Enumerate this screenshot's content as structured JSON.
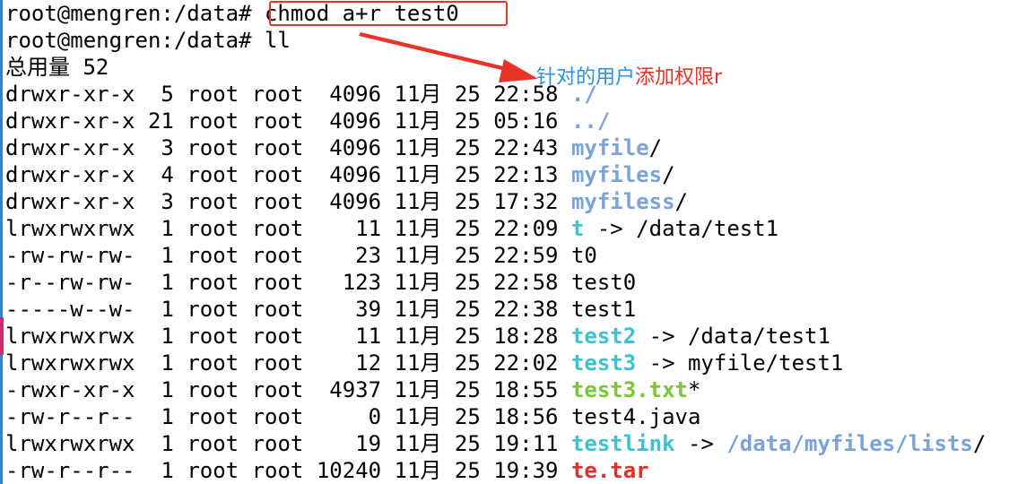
{
  "terminal": {
    "lines": [
      {
        "kind": "prompt",
        "prompt": "root@mengren:/data# ",
        "command": "chmod a+r test0"
      },
      {
        "kind": "prompt",
        "prompt": "root@mengren:/data# ",
        "command": "ll"
      },
      {
        "kind": "total",
        "text": "总用量 52"
      },
      {
        "kind": "entry",
        "perms": "drwxr-xr-x",
        "links": "5",
        "owner": "root",
        "group": "root",
        "size": "4096",
        "month": "11月",
        "day": "25",
        "time": "22:58",
        "name": "./",
        "name_color": "#7ba3d6",
        "name_bold": true
      },
      {
        "kind": "entry",
        "perms": "drwxr-xr-x",
        "links": "21",
        "owner": "root",
        "group": "root",
        "size": "4096",
        "month": "11月",
        "day": "25",
        "time": "05:16",
        "name": "../",
        "name_color": "#7ba3d6",
        "name_bold": true
      },
      {
        "kind": "entry",
        "perms": "drwxr-xr-x",
        "links": "3",
        "owner": "root",
        "group": "root",
        "size": "4096",
        "month": "11月",
        "day": "25",
        "time": "22:43",
        "name": "myfile",
        "suffix": "/",
        "name_color": "#7ba3d6",
        "name_bold": true
      },
      {
        "kind": "entry",
        "perms": "drwxr-xr-x",
        "links": "4",
        "owner": "root",
        "group": "root",
        "size": "4096",
        "month": "11月",
        "day": "25",
        "time": "22:13",
        "name": "myfiles",
        "suffix": "/",
        "name_color": "#7ba3d6",
        "name_bold": true
      },
      {
        "kind": "entry",
        "perms": "drwxr-xr-x",
        "links": "3",
        "owner": "root",
        "group": "root",
        "size": "4096",
        "month": "11月",
        "day": "25",
        "time": "17:32",
        "name": "myfiless",
        "suffix": "/",
        "name_color": "#7ba3d6",
        "name_bold": true
      },
      {
        "kind": "entry",
        "perms": "lrwxrwxrwx",
        "links": "1",
        "owner": "root",
        "group": "root",
        "size": "11",
        "month": "11月",
        "day": "25",
        "time": "22:09",
        "name": "t",
        "name_color": "#3cc2cc",
        "name_bold": true,
        "link": " -> ",
        "target": "/data/test1",
        "target_color": "#000000",
        "target_bold": false
      },
      {
        "kind": "entry",
        "perms": "-rw-rw-rw-",
        "links": "1",
        "owner": "root",
        "group": "root",
        "size": "23",
        "month": "11月",
        "day": "25",
        "time": "22:59",
        "name": "t0",
        "name_color": "#000000",
        "name_bold": false
      },
      {
        "kind": "entry",
        "perms": "-r--rw-rw-",
        "links": "1",
        "owner": "root",
        "group": "root",
        "size": "123",
        "month": "11月",
        "day": "25",
        "time": "22:58",
        "name": "test0",
        "name_color": "#000000",
        "name_bold": false
      },
      {
        "kind": "entry",
        "perms": "-----w--w-",
        "links": "1",
        "owner": "root",
        "group": "root",
        "size": "39",
        "month": "11月",
        "day": "25",
        "time": "22:38",
        "name": "test1",
        "name_color": "#000000",
        "name_bold": false
      },
      {
        "kind": "entry",
        "perms": "lrwxrwxrwx",
        "links": "1",
        "owner": "root",
        "group": "root",
        "size": "11",
        "month": "11月",
        "day": "25",
        "time": "18:28",
        "name": "test2",
        "name_color": "#3cc2cc",
        "name_bold": true,
        "link": " -> ",
        "target": "/data/test1",
        "target_color": "#000000",
        "target_bold": false
      },
      {
        "kind": "entry",
        "perms": "lrwxrwxrwx",
        "links": "1",
        "owner": "root",
        "group": "root",
        "size": "12",
        "month": "11月",
        "day": "25",
        "time": "22:02",
        "name": "test3",
        "name_color": "#3cc2cc",
        "name_bold": true,
        "link": " -> ",
        "target": "myfile/test1",
        "target_color": "#000000",
        "target_bold": false
      },
      {
        "kind": "entry",
        "perms": "-rwxr-xr-x",
        "links": "1",
        "owner": "root",
        "group": "root",
        "size": "4937",
        "month": "11月",
        "day": "25",
        "time": "18:55",
        "name": "test3.txt",
        "suffix": "*",
        "name_color": "#7cc43a",
        "name_bold": true
      },
      {
        "kind": "entry",
        "perms": "-rw-r--r--",
        "links": "1",
        "owner": "root",
        "group": "root",
        "size": "0",
        "month": "11月",
        "day": "25",
        "time": "18:56",
        "name": "test4.java",
        "name_color": "#000000",
        "name_bold": false
      },
      {
        "kind": "entry",
        "perms": "lrwxrwxrwx",
        "links": "1",
        "owner": "root",
        "group": "root",
        "size": "19",
        "month": "11月",
        "day": "25",
        "time": "19:11",
        "name": "testlink",
        "name_color": "#3cc2cc",
        "name_bold": true,
        "link": " -> ",
        "target": "/data/myfiles/lists",
        "target_color": "#7ba3d6",
        "target_bold": true,
        "suffix": "/"
      },
      {
        "kind": "entry",
        "perms": "-rw-r--r--",
        "links": "1",
        "owner": "root",
        "group": "root",
        "size": "10240",
        "month": "11月",
        "day": "25",
        "time": "19:39",
        "name": "te.tar",
        "name_color": "#e0302c",
        "name_bold": true
      }
    ]
  },
  "annotation": {
    "part1": "针对的用户",
    "part2": "添加权限r",
    "part1_color": "#2f8fe0",
    "part2_color": "#e8332a",
    "box_color": "#e8332a",
    "arrow_color": "#e8332a"
  }
}
